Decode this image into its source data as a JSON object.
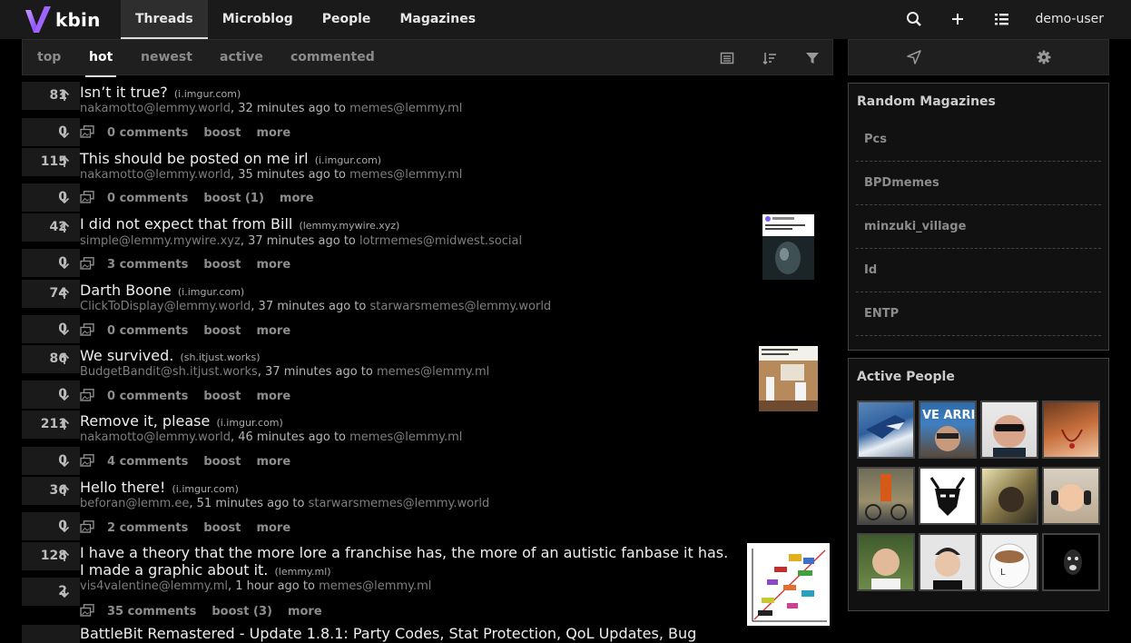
{
  "app": {
    "name": "kbin"
  },
  "nav": [
    "Threads",
    "Microblog",
    "People",
    "Magazines"
  ],
  "user": "demo-user",
  "sort_options": [
    "top",
    "hot",
    "newest",
    "active",
    "commented"
  ],
  "sidebar": {
    "random_magazines_title": "Random Magazines",
    "random_magazines": [
      "Pcs",
      "BPDmemes",
      "minzuki_village",
      "Id",
      "ENTP"
    ],
    "active_people_title": "Active People"
  },
  "entries": [
    {
      "up": "81",
      "down": "0",
      "title": "Isn’t it true?",
      "domain": "i.imgur.com",
      "author": "nakamotto@lemmy.world",
      "time": ", 32 minutes ago to ",
      "magazine": "memes@lemmy.ml",
      "comments": "0 comments",
      "boost": "boost",
      "more": "more"
    },
    {
      "up": "115",
      "down": "0",
      "title": "This should be posted on me irl",
      "domain": "i.imgur.com",
      "author": "nakamotto@lemmy.world",
      "time": ", 35 minutes ago to ",
      "magazine": "memes@lemmy.ml",
      "comments": "0 comments",
      "boost": "boost (1)",
      "more": "more"
    },
    {
      "up": "42",
      "down": "0",
      "title": "I did not expect that from Bill",
      "domain": "lemmy.mywire.xyz",
      "author": "simple@lemmy.mywire.xyz",
      "time": ", 37 minutes ago to ",
      "magazine": "lotrmemes@midwest.social",
      "comments": "3 comments",
      "boost": "boost",
      "more": "more"
    },
    {
      "up": "74",
      "down": "0",
      "title": "Darth Boone",
      "domain": "i.imgur.com",
      "author": "ClickToDisplay@lemmy.world",
      "time": ", 37 minutes ago to ",
      "magazine": "starwarsmemes@lemmy.world",
      "comments": "0 comments",
      "boost": "boost",
      "more": "more"
    },
    {
      "up": "86",
      "down": "0",
      "title": "We survived.",
      "domain": "sh.itjust.works",
      "author": "BudgetBandit@sh.itjust.works",
      "time": ", 37 minutes ago to ",
      "magazine": "memes@lemmy.ml",
      "comments": "0 comments",
      "boost": "boost",
      "more": "more"
    },
    {
      "up": "211",
      "down": "0",
      "title": "Remove it, please",
      "domain": "i.imgur.com",
      "author": "nakamotto@lemmy.world",
      "time": ", 46 minutes ago to ",
      "magazine": "memes@lemmy.ml",
      "comments": "4 comments",
      "boost": "boost",
      "more": "more"
    },
    {
      "up": "36",
      "down": "0",
      "title": "Hello there!",
      "domain": "i.imgur.com",
      "author": "beforan@lemm.ee",
      "time": ", 51 minutes ago to ",
      "magazine": "starwarsmemes@lemmy.world",
      "comments": "2 comments",
      "boost": "boost",
      "more": "more"
    },
    {
      "up": "128",
      "down": "2",
      "title_line1": "I have a theory that the more lore a franchise has, the more of an autistic fanbase it has.",
      "title_line2": "I made a graphic about it.",
      "domain": "lemmy.ml",
      "author": "vis4valentine@lemmy.ml",
      "time": ", 1 hour ago to ",
      "magazine": "memes@lemmy.ml",
      "comments": "35 comments",
      "boost": "boost (3)",
      "more": "more"
    },
    {
      "title": "BattleBit Remastered - Update 1.8.1: Party Codes, Stat Protection, QoL Updates, Bug"
    }
  ]
}
